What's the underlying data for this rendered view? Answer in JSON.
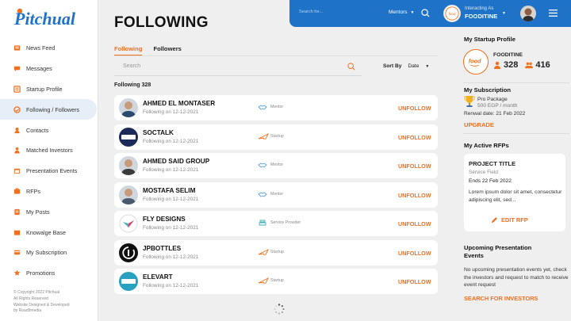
{
  "brand": {
    "logo_text": "Pitchual"
  },
  "sidebar": {
    "items": [
      {
        "label": "News Feed",
        "icon": "news-icon"
      },
      {
        "label": "Messages",
        "icon": "messages-icon"
      },
      {
        "label": "Startup Profile",
        "icon": "startup-icon"
      },
      {
        "label": "Following / Followers",
        "icon": "following-icon",
        "active": true
      },
      {
        "label": "Contacts",
        "icon": "contacts-icon"
      },
      {
        "label": "Matched Investors",
        "icon": "investors-icon"
      },
      {
        "label": "Presentation Events",
        "icon": "events-icon"
      },
      {
        "label": "RFPs",
        "icon": "rfp-icon"
      },
      {
        "label": "My Posts",
        "icon": "posts-icon"
      },
      {
        "label": "Knowalge Base",
        "icon": "knowledge-icon"
      },
      {
        "label": "My Subscription",
        "icon": "subscription-icon"
      },
      {
        "label": "Promotions",
        "icon": "promotions-icon"
      }
    ],
    "copyright": [
      "© Copyright 2022 Pitchual",
      "All Rights Reserved",
      "Website Designed & Developed",
      "by Road9media"
    ]
  },
  "topbar": {
    "search_placeholder": "Search for...",
    "mentors_select": "Mentors",
    "acting_label": "Interacting As",
    "acting_name": "FOODITINE",
    "acting_logo_text": "food"
  },
  "main": {
    "title": "FOLLOWING",
    "tabs": [
      "Following",
      "Followers"
    ],
    "search_placeholder": "Search",
    "sort_label": "Sort By",
    "sort_value": "Date",
    "count_label": "Following 328"
  },
  "rows": [
    {
      "name": "AHMED EL MONTASER",
      "sub": "Following on 12-12-2021",
      "type": "Mentor",
      "type_icon": "handshake-icon",
      "action": "UNFOLLOW",
      "avatar": "person",
      "avatar_color": "#2c4a6e"
    },
    {
      "name": "SOCTALK",
      "sub": "Following on 12-12-2021",
      "type": "Startup",
      "type_icon": "rocket-icon",
      "action": "UNFOLLOW",
      "avatar": "logo",
      "avatar_color": "#1c2a5a",
      "avatar_text": "SOCTALK"
    },
    {
      "name": "AHMED SAID GROUP",
      "sub": "Following on 12-12-2021",
      "type": "Mentor",
      "type_icon": "handshake-icon",
      "action": "UNFOLLOW",
      "avatar": "person",
      "avatar_color": "#3a3a3a"
    },
    {
      "name": "MOSTAFA SELIM",
      "sub": "Following on 12-12-2021",
      "type": "Mentor",
      "type_icon": "handshake-icon",
      "action": "UNFOLLOW",
      "avatar": "person",
      "avatar_color": "#4a5a6e"
    },
    {
      "name": "FLY DESIGNS",
      "sub": "Following on 12-12-2021",
      "type": "Service Provider",
      "type_icon": "service-icon",
      "action": "UNFOLLOW",
      "avatar": "fly",
      "avatar_color": "#ffffff"
    },
    {
      "name": "JPBOTTLES",
      "sub": "Following on 12-12-2021",
      "type": "Startup",
      "type_icon": "rocket-icon",
      "action": "UNFOLLOW",
      "avatar": "dark",
      "avatar_color": "#111111"
    },
    {
      "name": "ELEVART",
      "sub": "Following on 12-12-2021",
      "type": "Startup",
      "type_icon": "rocket-icon",
      "action": "UNFOLLOW",
      "avatar": "logo",
      "avatar_color": "#2aa0c0",
      "avatar_text": "ELEVART"
    }
  ],
  "right": {
    "profile_heading": "My Startup Profile",
    "profile_name": "FOODITINE",
    "profile_logo_text": "food",
    "followers": "328",
    "following": "416",
    "sub_heading": "My Subscription",
    "sub_package": "Pro Package",
    "sub_price": "500 EGP / month",
    "sub_renewal": "Renwal date: 21 Feb 2022",
    "sub_upgrade": "UPGRADE",
    "rfp_heading": "My Active RFPs",
    "rfp_title": "PROJECT TITLE",
    "rfp_field": "Service Field",
    "rfp_ends": "Ends 22 Feb 2022",
    "rfp_desc": "Lorem ipsum dolor sit amet, consectetur adipiscing elit, sed...",
    "rfp_edit": "EDIT RFP",
    "upc_heading_1": "Upcoming Presentation",
    "upc_heading_2": "Events",
    "upc_text": "No upcoming presentation events yet, check the investors and request to match to receive event request",
    "upc_link": "SEARCH FOR  INVESTORS"
  },
  "colors": {
    "accent": "#f07020",
    "brand_blue": "#1e72c7",
    "active_nav": "#e6eef7"
  }
}
